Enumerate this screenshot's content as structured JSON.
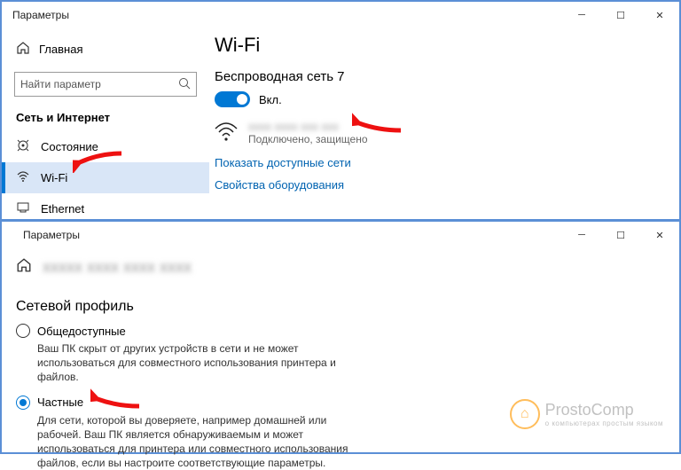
{
  "top": {
    "title": "Параметры",
    "home": "Главная",
    "search_placeholder": "Найти параметр",
    "section": "Сеть и Интернет",
    "nav": {
      "status": "Состояние",
      "wifi": "Wi-Fi",
      "ethernet": "Ethernet"
    },
    "content": {
      "heading": "Wi-Fi",
      "subheading": "Беспроводная сеть 7",
      "toggle_label": "Вкл.",
      "network_name_obscured": "xxxx xxxx xxx xxx",
      "network_status": "Подключено, защищено",
      "link_available": "Показать доступные сети",
      "link_hw": "Свойства оборудования"
    }
  },
  "bottom": {
    "title": "Параметры",
    "network_name_obscured": "xxxxx xxxx xxxx xxxx",
    "profile_heading": "Сетевой профиль",
    "public": {
      "label": "Общедоступные",
      "desc": "Ваш ПК скрыт от других устройств в сети и не может использоваться для совместного использования принтера и файлов."
    },
    "private": {
      "label": "Частные",
      "desc": "Для сети, которой вы доверяете, например домашней или рабочей. Ваш ПК является обнаруживаемым и может использоваться для принтера или совместного использования файлов, если вы настроите соответствующие параметры."
    }
  },
  "watermark": {
    "name": "ProstoComp",
    "tagline": "о компьютерах простым языком"
  }
}
